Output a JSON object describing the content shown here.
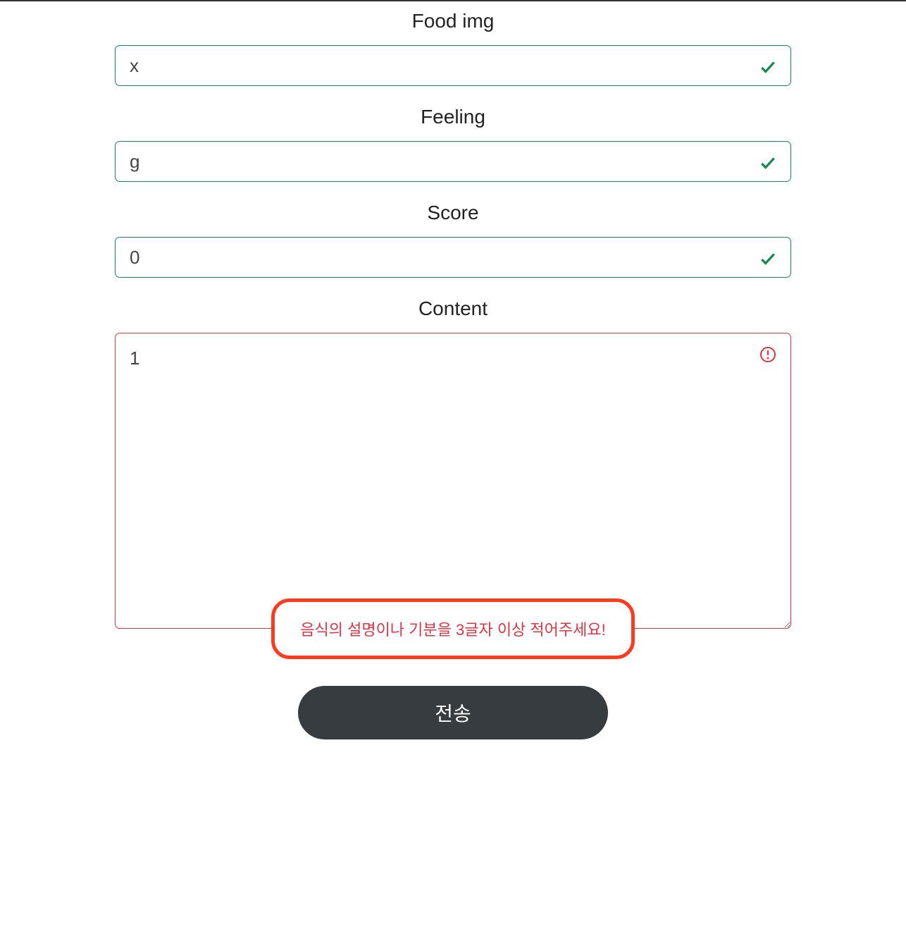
{
  "fields": {
    "food_img": {
      "label": "Food img",
      "value": "x",
      "state": "valid"
    },
    "feeling": {
      "label": "Feeling",
      "value": "g",
      "state": "valid"
    },
    "score": {
      "label": "Score",
      "value": "0",
      "state": "valid"
    },
    "content": {
      "label": "Content",
      "value": "1",
      "state": "invalid",
      "error": "음식의 설명이나 기분을 3글자 이상 적어주세요!"
    }
  },
  "submit": {
    "label": "전송"
  }
}
